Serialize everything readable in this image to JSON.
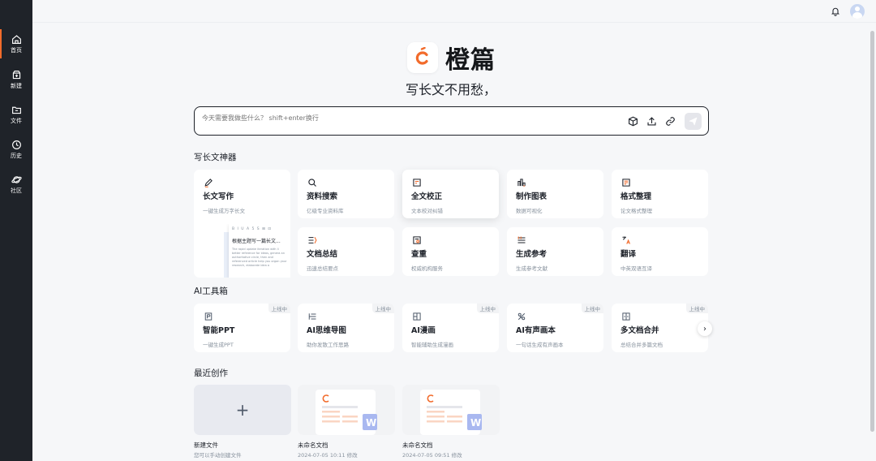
{
  "sidebar": {
    "items": [
      {
        "label": "首页",
        "icon": "home-icon"
      },
      {
        "label": "新建",
        "icon": "new-icon"
      },
      {
        "label": "文件",
        "icon": "folder-icon"
      },
      {
        "label": "历史",
        "icon": "history-icon"
      },
      {
        "label": "社区",
        "icon": "planet-icon"
      }
    ]
  },
  "brand": {
    "name": "橙篇",
    "accent": "#f26b2b"
  },
  "slogan": "写长文不用愁，",
  "search": {
    "placeholder": "今天需要我做些什么？ shift+enter换行"
  },
  "sections": {
    "writing": "写长文神器",
    "ai_tools": "AI工具箱",
    "recent": "最近创作"
  },
  "writing_cards": [
    {
      "title": "长文写作",
      "desc": "一键生成万字长文",
      "icon": "pen-icon"
    },
    {
      "title": "资料搜索",
      "desc": "亿级专业资料库",
      "icon": "search-icon"
    },
    {
      "title": "全文校正",
      "desc": "文本校对纠错",
      "icon": "proofread-icon"
    },
    {
      "title": "制作图表",
      "desc": "数据可视化",
      "icon": "chart-icon"
    },
    {
      "title": "格式整理",
      "desc": "论文格式整理",
      "icon": "format-icon"
    },
    {
      "title": "文档总结",
      "desc": "迅速总结要点",
      "icon": "summary-icon"
    },
    {
      "title": "查重",
      "desc": "权威机构服务",
      "icon": "duplicate-check-icon"
    },
    {
      "title": "生成参考",
      "desc": "生成参考文献",
      "icon": "reference-icon"
    },
    {
      "title": "翻译",
      "desc": "中英双语互译",
      "icon": "translate-icon"
    }
  ],
  "preview": {
    "toolbar": "B I U A 5 S ⊞ ⊡",
    "title": "根据主题写一篇长文...",
    "body": "The rapid update iteration with li better reference for ideas, genera an authoritative circle, then and referenced article help you organ your research, elaborate idea a"
  },
  "ai_tools": [
    {
      "title": "智能PPT",
      "desc": "一键生成PPT",
      "tag": "上线中",
      "icon": "ppt-icon"
    },
    {
      "title": "AI思维导图",
      "desc": "助你发散工作思路",
      "tag": "上线中",
      "icon": "mindmap-icon"
    },
    {
      "title": "AI漫画",
      "desc": "智能辅助生成漫画",
      "tag": "上线中",
      "icon": "comic-icon"
    },
    {
      "title": "AI有声画本",
      "desc": "一句话生成有声画本",
      "tag": "上线中",
      "icon": "audiobook-icon"
    },
    {
      "title": "多文档合并",
      "desc": "总结合并多篇文档",
      "tag": "上线中",
      "icon": "merge-icon"
    }
  ],
  "recent": [
    {
      "name": "新建文件",
      "sub": "您可以手动创建文件"
    },
    {
      "name": "未命名文档",
      "sub": "2024-07-05 10:11 修改"
    },
    {
      "name": "未命名文档",
      "sub": "2024-07-05 09:51 修改"
    }
  ],
  "new_plus": "+",
  "next_arrow": "›"
}
